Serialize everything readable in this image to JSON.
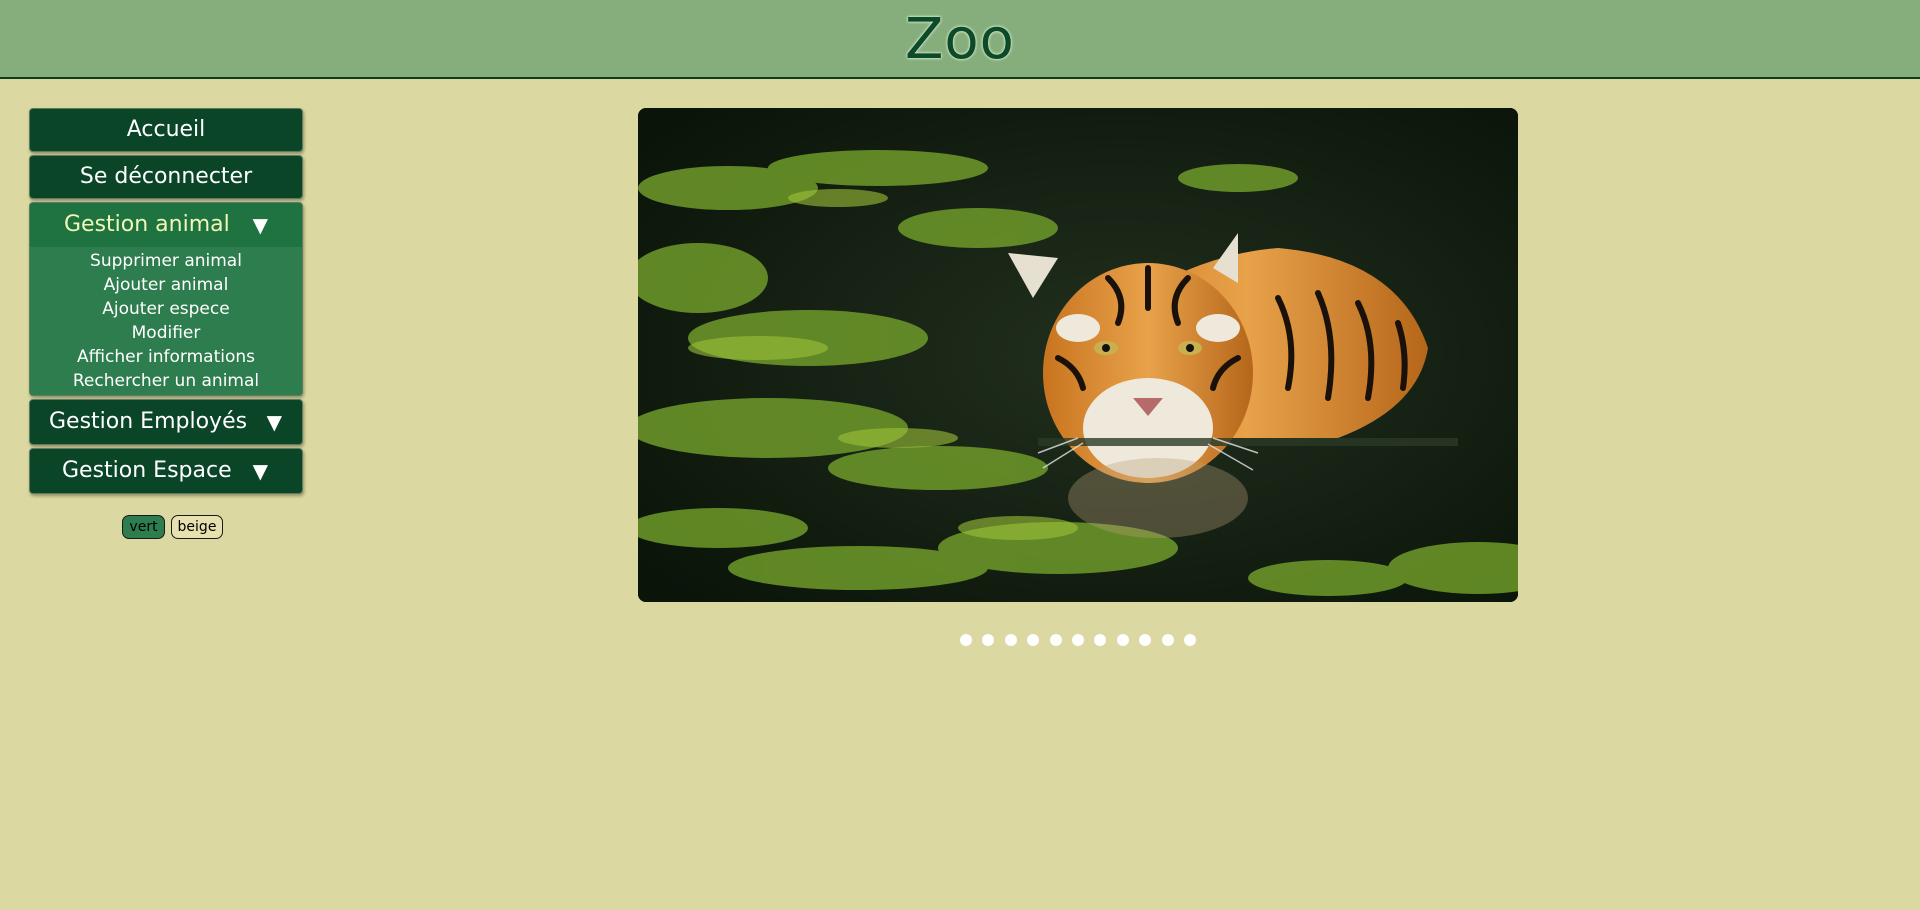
{
  "header": {
    "title": "Zoo"
  },
  "menu": {
    "home": "Accueil",
    "logout": "Se déconnecter",
    "animal": {
      "label": "Gestion animal",
      "arrow": "▼",
      "items": [
        "Supprimer animal",
        "Ajouter animal",
        "Ajouter espece",
        "Modifier",
        "Afficher informations",
        "Rechercher un animal"
      ]
    },
    "employes": {
      "label": "Gestion Employés",
      "arrow": "▼"
    },
    "espace": {
      "label": "Gestion Espace",
      "arrow": "▼"
    }
  },
  "theme": {
    "vert": "vert",
    "beige": "beige"
  },
  "slideshow": {
    "dots": 11,
    "subject": "tiger swimming in green water"
  },
  "colors": {
    "page_bg": "#dcd8a2",
    "header_bg": "#86ae7c",
    "menu_btn": "#0b4527",
    "dropdown_open": "#2e7d4f"
  }
}
